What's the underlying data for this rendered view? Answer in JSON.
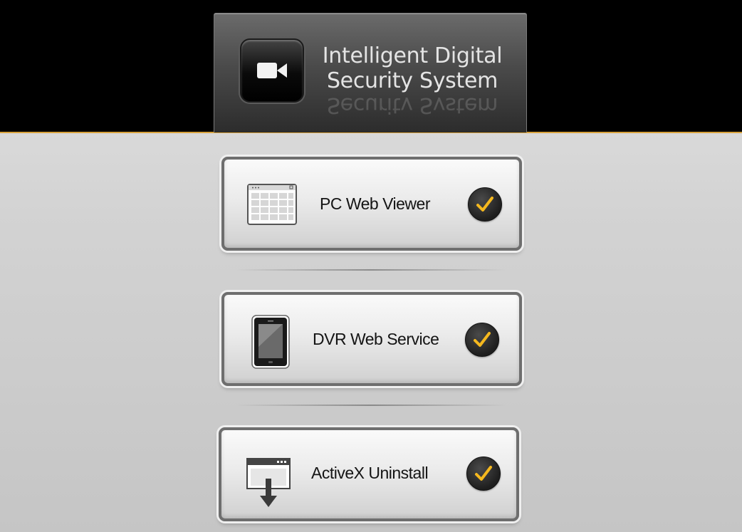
{
  "header": {
    "title_line1": "Intelligent Digital",
    "title_line2": "Security System",
    "logo_icon": "video-camera-icon"
  },
  "buttons": [
    {
      "label": "PC Web Viewer",
      "icon": "browser-grid-icon",
      "status_icon": "checkmark-icon"
    },
    {
      "label": "DVR Web Service",
      "icon": "mobile-phone-icon",
      "status_icon": "checkmark-icon"
    },
    {
      "label": "ActiveX Uninstall",
      "icon": "download-window-icon",
      "status_icon": "checkmark-icon"
    }
  ],
  "colors": {
    "accent": "#d8a23c",
    "checkmark": "#f5b81e",
    "header_bg": "#000000"
  }
}
